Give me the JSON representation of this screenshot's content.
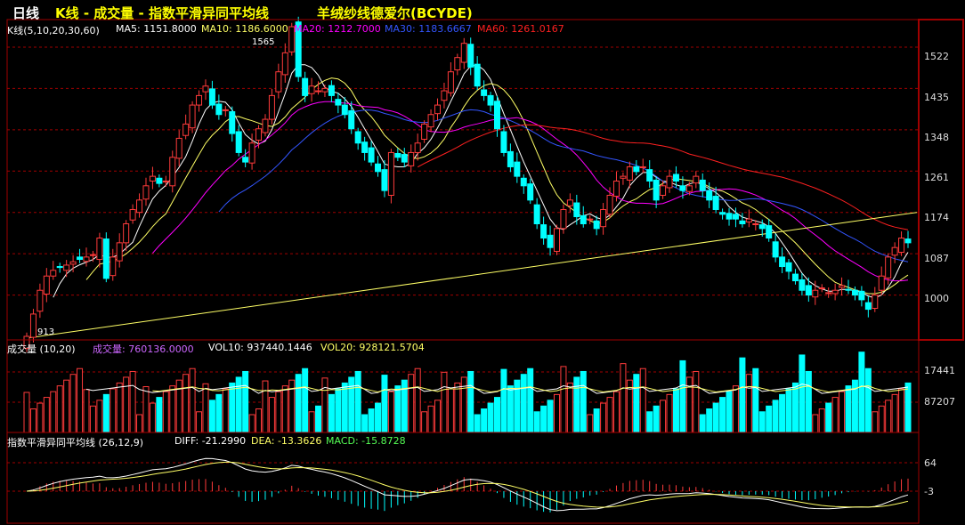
{
  "header": {
    "period": "日线",
    "title": "K线 - 成交量 - 指数平滑异同平均线",
    "stock": "羊绒纱线德爱尔(BCYDE)"
  },
  "colors": {
    "up": "#ff3b3b",
    "down": "#00ffff",
    "grid": "#a00000",
    "ma5": "#ffffff",
    "ma10": "#ffff66",
    "ma20": "#ff00ff",
    "ma30": "#3355ff",
    "ma60": "#ff2020",
    "vol_label": "#cc66ff"
  },
  "kline_panel": {
    "label": "K线(5,10,20,30,60)",
    "ma_values": [
      {
        "key": "ma5",
        "text": "MA5: 1151.8000"
      },
      {
        "key": "ma10",
        "text": "MA10: 1186.6000"
      },
      {
        "key": "ma20",
        "text": "MA20: 1212.7000"
      },
      {
        "key": "ma30",
        "text": "MA30: 1183.6667"
      },
      {
        "key": "ma60",
        "text": "MA60: 1261.0167"
      }
    ],
    "high_marker": "1565",
    "low_marker": "913",
    "y_ticks": [
      "1522",
      "1435",
      "1348",
      "1261",
      "1174",
      "1087",
      "1000"
    ]
  },
  "volume_panel": {
    "label": "成交量 (10,20)",
    "values": [
      {
        "key": "vol",
        "text": "成交量: 760136.0000"
      },
      {
        "key": "vol10",
        "text": "VOL10: 937440.1446"
      },
      {
        "key": "vol20",
        "text": "VOL20: 928121.5704"
      }
    ],
    "y_ticks": [
      "17441",
      "87207"
    ]
  },
  "macd_panel": {
    "label": "指数平滑异同平均线 (26,12,9)",
    "values": [
      {
        "key": "diff",
        "text": "DIFF: -21.2990"
      },
      {
        "key": "dea",
        "text": "DEA: -13.3626"
      },
      {
        "key": "macd",
        "text": "MACD: -15.8728"
      }
    ],
    "y_ticks": [
      "64",
      "-3"
    ]
  },
  "chart_data": {
    "type": "candlestick",
    "price_range": [
      913,
      1565
    ],
    "closes": [
      913,
      960,
      1010,
      1040,
      1052,
      1058,
      1063,
      1070,
      1075,
      1080,
      1085,
      1120,
      1035,
      1080,
      1110,
      1150,
      1180,
      1200,
      1230,
      1250,
      1235,
      1240,
      1290,
      1330,
      1360,
      1400,
      1420,
      1440,
      1400,
      1380,
      1390,
      1340,
      1300,
      1280,
      1320,
      1350,
      1370,
      1420,
      1470,
      1510,
      1565,
      1460,
      1420,
      1440,
      1430,
      1435,
      1420,
      1400,
      1380,
      1350,
      1320,
      1300,
      1280,
      1260,
      1220,
      1300,
      1290,
      1280,
      1300,
      1320,
      1360,
      1380,
      1400,
      1430,
      1470,
      1500,
      1530,
      1480,
      1440,
      1420,
      1400,
      1350,
      1300,
      1270,
      1250,
      1230,
      1200,
      1150,
      1120,
      1100,
      1140,
      1180,
      1200,
      1165,
      1150,
      1160,
      1140,
      1180,
      1210,
      1240,
      1250,
      1270,
      1260,
      1270,
      1240,
      1200,
      1230,
      1250,
      1240,
      1220,
      1230,
      1250,
      1220,
      1200,
      1180,
      1170,
      1160,
      1160,
      1150,
      1160,
      1150,
      1140,
      1120,
      1080,
      1060,
      1050,
      1030,
      1010,
      1000,
      1010,
      1015,
      1005,
      1010,
      1020,
      1010,
      1000,
      990,
      970,
      1000,
      1040,
      1080,
      1100,
      1120,
      1110
    ]
  }
}
